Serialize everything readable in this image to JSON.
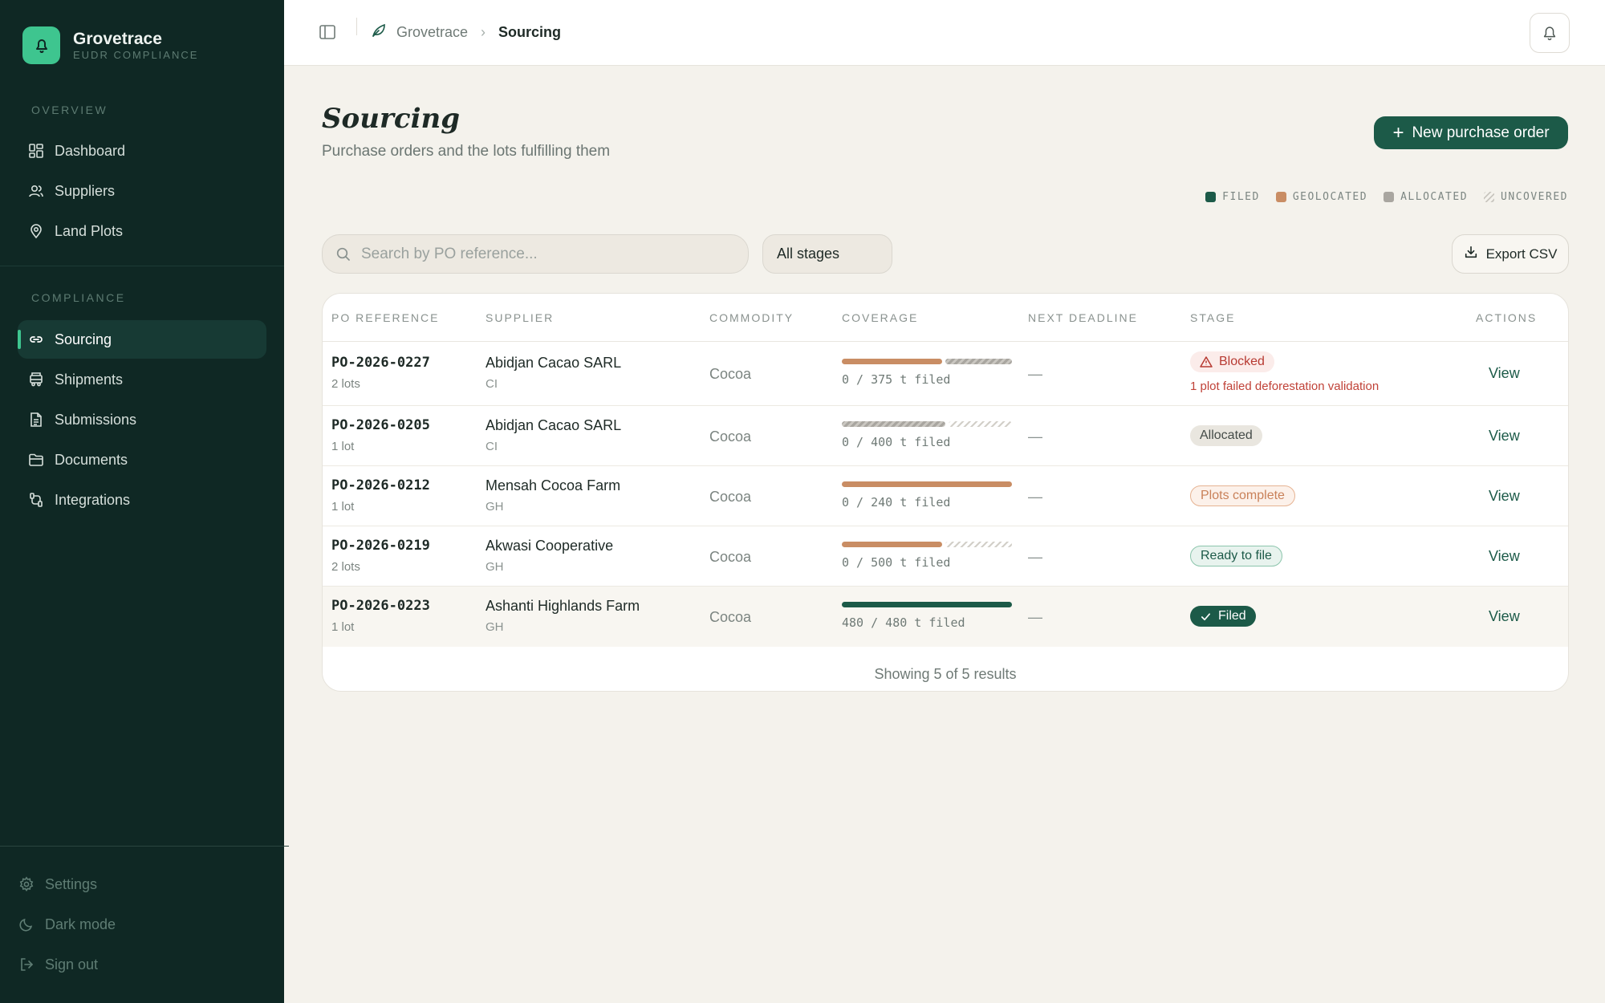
{
  "brand": {
    "name": "Grovetrace",
    "subtitle": "EUDR COMPLIANCE"
  },
  "sidebar": {
    "sections": [
      {
        "label": "OVERVIEW",
        "items": [
          {
            "label": "Dashboard",
            "icon": "grid-icon"
          },
          {
            "label": "Suppliers",
            "icon": "users-icon"
          },
          {
            "label": "Land Plots",
            "icon": "map-pin-icon"
          }
        ]
      },
      {
        "label": "COMPLIANCE",
        "items": [
          {
            "label": "Sourcing",
            "icon": "link-icon",
            "active": true
          },
          {
            "label": "Shipments",
            "icon": "truck-icon"
          },
          {
            "label": "Submissions",
            "icon": "file-text-icon"
          },
          {
            "label": "Documents",
            "icon": "folder-icon"
          },
          {
            "label": "Integrations",
            "icon": "plug-icon"
          }
        ]
      }
    ],
    "bottom": [
      {
        "label": "Settings",
        "icon": "gear-icon"
      },
      {
        "label": "Dark mode",
        "icon": "moon-icon"
      },
      {
        "label": "Sign out",
        "icon": "log-out-icon"
      }
    ]
  },
  "topbar": {
    "breadcrumb": [
      "Grovetrace",
      "Sourcing"
    ]
  },
  "page": {
    "title": "Sourcing",
    "subtitle": "Purchase orders and the lots fulfilling them",
    "new_button": "New purchase order"
  },
  "legend": [
    {
      "label": "FILED",
      "color": "#1c5a48"
    },
    {
      "label": "GEOLOCATED",
      "color": "#c98d64"
    },
    {
      "label": "ALLOCATED",
      "color": "#a9a6a0"
    },
    {
      "label": "UNCOVERED",
      "color": "hatched"
    }
  ],
  "filters": {
    "search_placeholder": "Search by PO reference...",
    "stage_selected": "All stages",
    "export_label": "Export CSV"
  },
  "table": {
    "columns": [
      "PO REFERENCE",
      "SUPPLIER",
      "COMMODITY",
      "COVERAGE",
      "NEXT DEADLINE",
      "STAGE",
      "ACTIONS"
    ],
    "rows": [
      {
        "po": "PO-2026-0227",
        "lots": "2 lots",
        "supplier": "Abidjan Cacao SARL",
        "country": "CI",
        "commodity": "Cocoa",
        "coverage": {
          "filed": 0,
          "geolocated": 0.6,
          "allocated": 0.4,
          "uncovered": 0
        },
        "coverage_text": "0 / 375 t filed",
        "deadline": "—",
        "stage": "Blocked",
        "stage_note": "1 plot failed deforestation validation",
        "action": "View"
      },
      {
        "po": "PO-2026-0205",
        "lots": "1 lot",
        "supplier": "Abidjan Cacao SARL",
        "country": "CI",
        "commodity": "Cocoa",
        "coverage": {
          "filed": 0,
          "geolocated": 0,
          "allocated": 0.62,
          "uncovered": 0.38
        },
        "coverage_text": "0 / 400 t filed",
        "deadline": "—",
        "stage": "Allocated",
        "stage_note": "",
        "action": "View"
      },
      {
        "po": "PO-2026-0212",
        "lots": "1 lot",
        "supplier": "Mensah Cocoa Farm",
        "country": "GH",
        "commodity": "Cocoa",
        "coverage": {
          "filed": 0,
          "geolocated": 1,
          "allocated": 0,
          "uncovered": 0
        },
        "coverage_text": "0 / 240 t filed",
        "deadline": "—",
        "stage": "Plots complete",
        "stage_note": "",
        "action": "View"
      },
      {
        "po": "PO-2026-0219",
        "lots": "2 lots",
        "supplier": "Akwasi Cooperative",
        "country": "GH",
        "commodity": "Cocoa",
        "coverage": {
          "filed": 0,
          "geolocated": 0.6,
          "allocated": 0,
          "uncovered": 0.4
        },
        "coverage_text": "0 / 500 t filed",
        "deadline": "—",
        "stage": "Ready to file",
        "stage_note": "",
        "action": "View"
      },
      {
        "po": "PO-2026-0223",
        "lots": "1 lot",
        "supplier": "Ashanti Highlands Farm",
        "country": "GH",
        "commodity": "Cocoa",
        "coverage": {
          "filed": 1,
          "geolocated": 0,
          "allocated": 0,
          "uncovered": 0
        },
        "coverage_text": "480 / 480 t filed",
        "deadline": "—",
        "stage": "Filed",
        "stage_note": "",
        "action": "View"
      }
    ],
    "footer": "Showing 5 of 5 results"
  }
}
